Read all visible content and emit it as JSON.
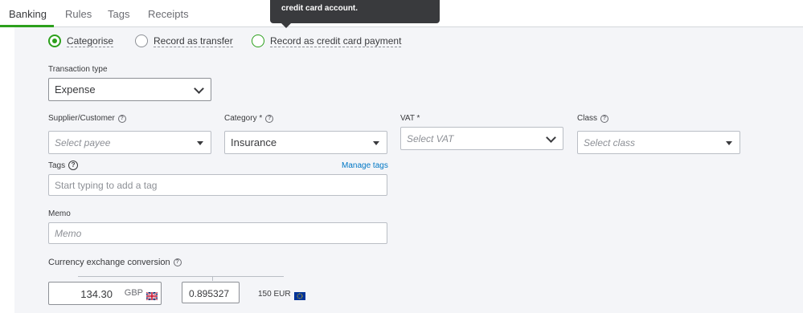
{
  "tabs": [
    {
      "label": "Banking",
      "active": true
    },
    {
      "label": "Rules"
    },
    {
      "label": "Tags"
    },
    {
      "label": "Receipts"
    }
  ],
  "tooltip": {
    "text": "credit card account."
  },
  "radios": [
    {
      "label": "Categorise",
      "checked": true
    },
    {
      "label": "Record as transfer"
    },
    {
      "label": "Record as credit card payment"
    }
  ],
  "transaction_type": {
    "label": "Transaction type",
    "value": "Expense"
  },
  "supplier": {
    "label": "Supplier/Customer",
    "placeholder": "Select payee"
  },
  "category": {
    "label": "Category *",
    "value": "Insurance"
  },
  "vat": {
    "label": "VAT *",
    "placeholder": "Select VAT"
  },
  "class_field": {
    "label": "Class",
    "placeholder": "Select class"
  },
  "tags": {
    "label": "Tags",
    "manage_link": "Manage tags",
    "placeholder": "Start typing to add a tag"
  },
  "memo": {
    "label": "Memo",
    "placeholder": "Memo"
  },
  "currency": {
    "label": "Currency exchange conversion",
    "amount": "134.30",
    "currency_code": "GBP",
    "rate": "0.895327",
    "converted": "150 EUR"
  },
  "colors": {
    "accent": "#2ca01c",
    "link": "#0077c5",
    "panel": "#f4f5f8",
    "tooltip": "#393a3d"
  }
}
